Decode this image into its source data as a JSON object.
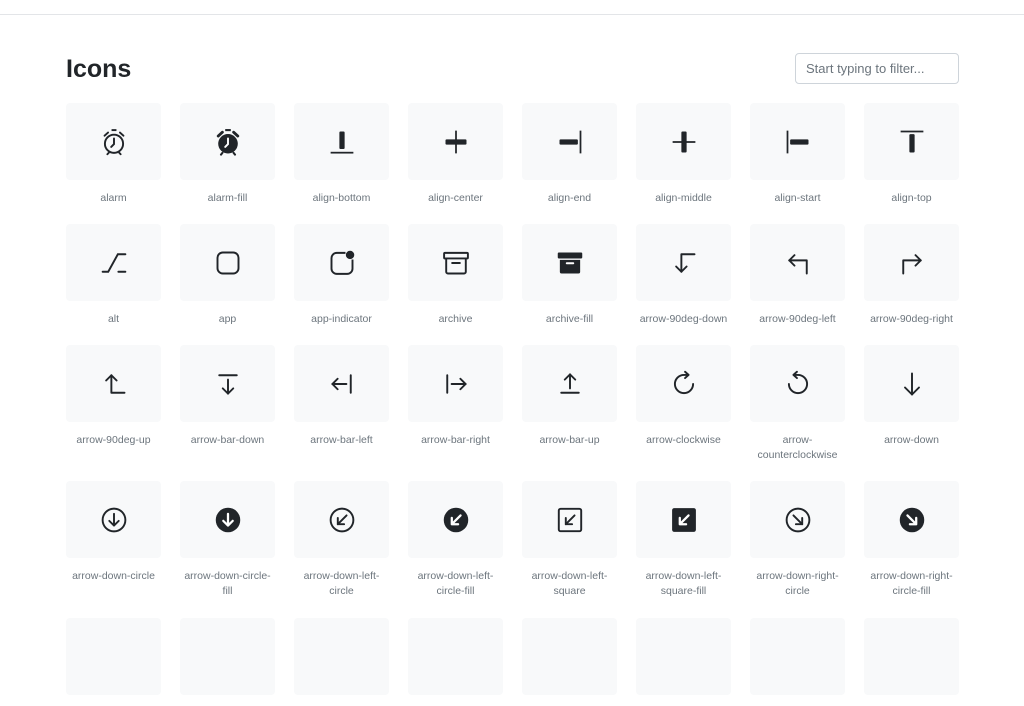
{
  "page": {
    "title": "Icons"
  },
  "filter": {
    "placeholder": "Start typing to filter..."
  },
  "icons": [
    {
      "label": "alarm",
      "icon": "alarm-icon"
    },
    {
      "label": "alarm-fill",
      "icon": "alarm-fill-icon"
    },
    {
      "label": "align-bottom",
      "icon": "align-bottom-icon"
    },
    {
      "label": "align-center",
      "icon": "align-center-icon"
    },
    {
      "label": "align-end",
      "icon": "align-end-icon"
    },
    {
      "label": "align-middle",
      "icon": "align-middle-icon"
    },
    {
      "label": "align-start",
      "icon": "align-start-icon"
    },
    {
      "label": "align-top",
      "icon": "align-top-icon"
    },
    {
      "label": "alt",
      "icon": "alt-icon"
    },
    {
      "label": "app",
      "icon": "app-icon"
    },
    {
      "label": "app-indicator",
      "icon": "app-indicator-icon"
    },
    {
      "label": "archive",
      "icon": "archive-icon"
    },
    {
      "label": "archive-fill",
      "icon": "archive-fill-icon"
    },
    {
      "label": "arrow-90deg-down",
      "icon": "arrow-90deg-down-icon"
    },
    {
      "label": "arrow-90deg-left",
      "icon": "arrow-90deg-left-icon"
    },
    {
      "label": "arrow-90deg-right",
      "icon": "arrow-90deg-right-icon"
    },
    {
      "label": "arrow-90deg-up",
      "icon": "arrow-90deg-up-icon"
    },
    {
      "label": "arrow-bar-down",
      "icon": "arrow-bar-down-icon"
    },
    {
      "label": "arrow-bar-left",
      "icon": "arrow-bar-left-icon"
    },
    {
      "label": "arrow-bar-right",
      "icon": "arrow-bar-right-icon"
    },
    {
      "label": "arrow-bar-up",
      "icon": "arrow-bar-up-icon"
    },
    {
      "label": "arrow-clockwise",
      "icon": "arrow-clockwise-icon"
    },
    {
      "label": "arrow-counterclockwise",
      "icon": "arrow-counterclockwise-icon"
    },
    {
      "label": "arrow-down",
      "icon": "arrow-down-icon"
    },
    {
      "label": "arrow-down-circle",
      "icon": "arrow-down-circle-icon"
    },
    {
      "label": "arrow-down-circle-fill",
      "icon": "arrow-down-circle-fill-icon"
    },
    {
      "label": "arrow-down-left-circle",
      "icon": "arrow-down-left-circle-icon"
    },
    {
      "label": "arrow-down-left-circle-fill",
      "icon": "arrow-down-left-circle-fill-icon"
    },
    {
      "label": "arrow-down-left-square",
      "icon": "arrow-down-left-square-icon"
    },
    {
      "label": "arrow-down-left-square-fill",
      "icon": "arrow-down-left-square-fill-icon"
    },
    {
      "label": "arrow-down-right-circle",
      "icon": "arrow-down-right-circle-icon"
    },
    {
      "label": "arrow-down-right-circle-fill",
      "icon": "arrow-down-right-circle-fill-icon"
    },
    {
      "label": "",
      "icon": "partial-icon"
    },
    {
      "label": "",
      "icon": "partial-icon"
    },
    {
      "label": "",
      "icon": "partial-icon"
    },
    {
      "label": "",
      "icon": "partial-icon"
    },
    {
      "label": "",
      "icon": "partial-icon"
    },
    {
      "label": "",
      "icon": "partial-icon"
    },
    {
      "label": "",
      "icon": "partial-icon"
    },
    {
      "label": "",
      "icon": "partial-icon"
    }
  ]
}
